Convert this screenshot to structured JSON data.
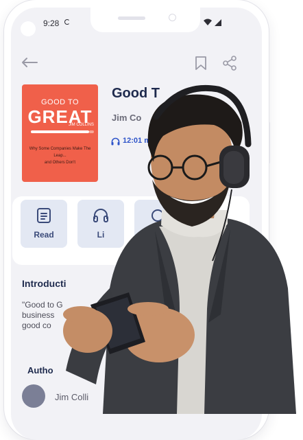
{
  "status_bar": {
    "time": "9:28"
  },
  "nav": {
    "back_icon": "arrow-left-icon",
    "bookmark_icon": "bookmark-icon",
    "share_icon": "share-icon"
  },
  "cover": {
    "top_line": "GOOD TO",
    "main_line": "GREAT",
    "author_line": "JIM COLLINS",
    "subtitle_line1": "Why Some Companies Make The",
    "subtitle_line2": "Leap...",
    "subtitle_line3": "and Others Don't",
    "color": "#f0604a"
  },
  "book": {
    "title": "Good T",
    "author": "Jim Co",
    "duration": "12:01 m"
  },
  "actions": [
    {
      "label": "Read",
      "icon": "document-icon"
    },
    {
      "label": "Li",
      "icon": "headphones-icon"
    },
    {
      "label": "",
      "icon": "more-icon"
    }
  ],
  "intro": {
    "title": "Introducti",
    "line1": "\"Good to G",
    "line2": "business",
    "line3": "good co"
  },
  "author_section": {
    "title": "Autho",
    "name": "Jim Colli"
  },
  "colors": {
    "accent": "#2e54c9",
    "heading": "#1e2a4d",
    "action_bg": "#e3e8f3",
    "screen_bg": "#f2f2f6"
  }
}
